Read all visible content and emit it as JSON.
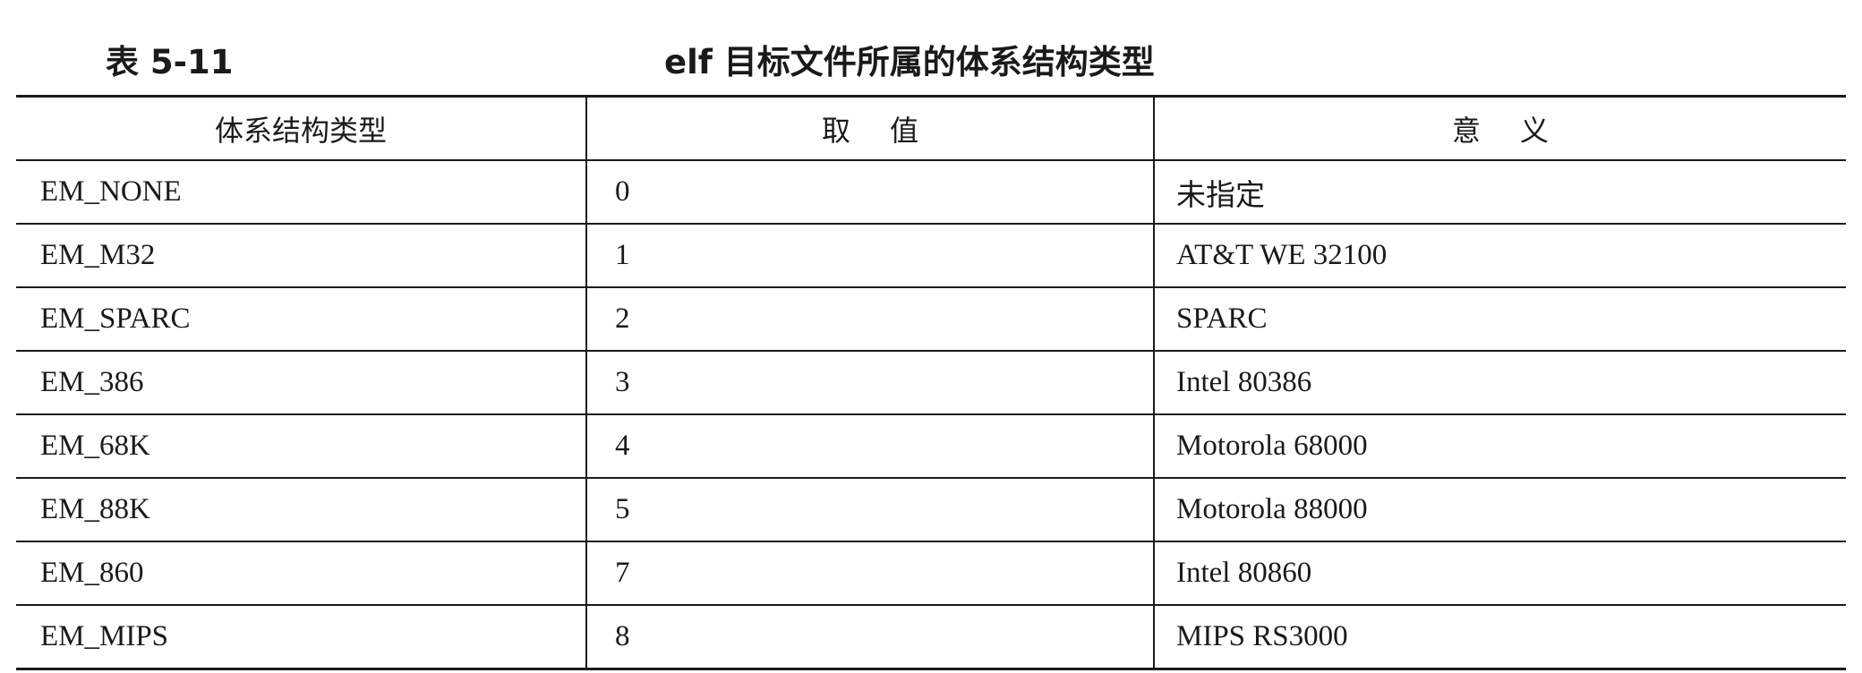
{
  "caption": {
    "number": "表 5-11",
    "title": "elf 目标文件所属的体系结构类型"
  },
  "table": {
    "headers": [
      "体系结构类型",
      "取值",
      "意义"
    ],
    "rows": [
      {
        "name": "EM_NONE",
        "value": "0",
        "meaning": "未指定"
      },
      {
        "name": "EM_M32",
        "value": "1",
        "meaning": "AT&T WE 32100"
      },
      {
        "name": "EM_SPARC",
        "value": "2",
        "meaning": "SPARC"
      },
      {
        "name": "EM_386",
        "value": "3",
        "meaning": "Intel 80386"
      },
      {
        "name": "EM_68K",
        "value": "4",
        "meaning": "Motorola 68000"
      },
      {
        "name": "EM_88K",
        "value": "5",
        "meaning": "Motorola 88000"
      },
      {
        "name": "EM_860",
        "value": "7",
        "meaning": "Intel 80860"
      },
      {
        "name": "EM_MIPS",
        "value": "8",
        "meaning": "MIPS RS3000"
      }
    ]
  }
}
